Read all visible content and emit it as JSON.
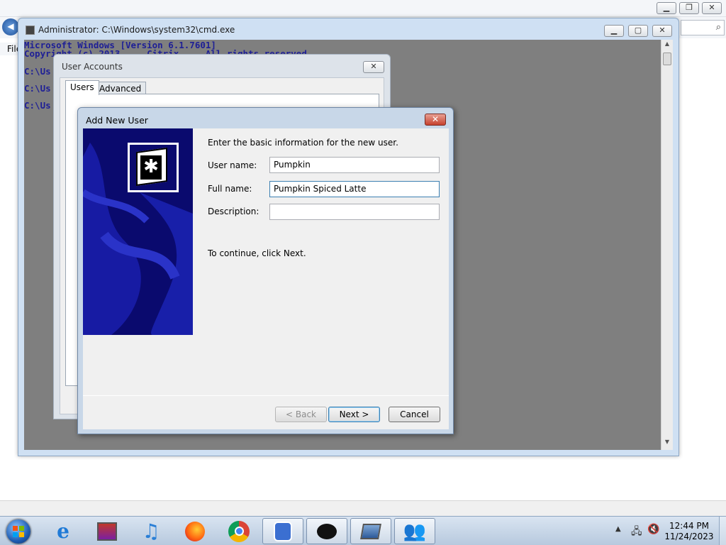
{
  "cmd": {
    "title": "Administrator: C:\\Windows\\system32\\cmd.exe",
    "lines": [
      "Microsoft Windows [Version 6.1.7601]",
      "Copyright (c) 2013 ... Citrix ... All rights reserved.",
      "C:\\Us",
      "C:\\Us",
      "C:\\Us"
    ]
  },
  "background": {
    "menu_label": "File"
  },
  "user_accounts": {
    "title": "User Accounts",
    "tabs": [
      "Users",
      "Advanced"
    ]
  },
  "add_user": {
    "title": "Add New User",
    "intro": "Enter the basic information for the new user.",
    "username_label": "User name:",
    "username_value": "Pumpkin",
    "fullname_label": "Full name:",
    "fullname_value": "Pumpkin Spiced Latte",
    "description_label": "Description:",
    "description_value": "",
    "continue_text": "To continue, click Next.",
    "back_label": "< Back",
    "next_label": "Next >",
    "cancel_label": "Cancel"
  },
  "taskbar": {
    "apps": [
      "internet-explorer-icon",
      "archive-icon",
      "itunes-icon",
      "firefox-icon",
      "chrome-icon",
      "robot-app-icon",
      "ink-app-icon",
      "computer-icon",
      "user-accounts-icon"
    ],
    "time": "12:44 PM",
    "date": "11/24/2023"
  }
}
